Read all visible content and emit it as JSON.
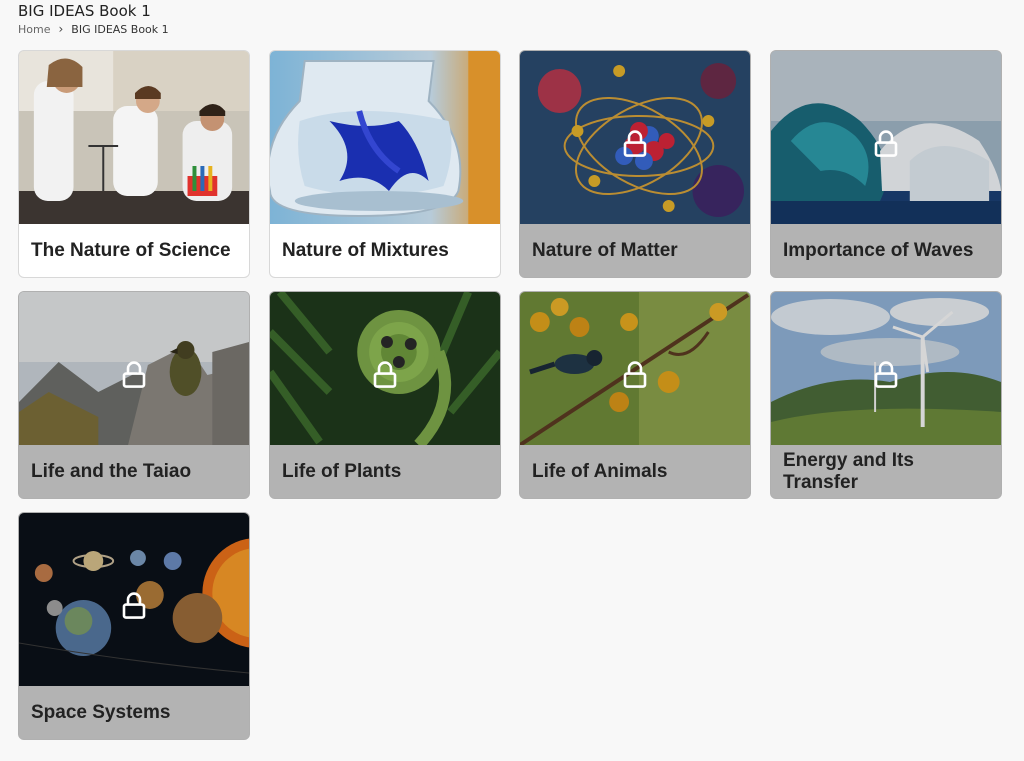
{
  "header": {
    "title": "BIG IDEAS Book 1",
    "breadcrumb": {
      "home": "Home",
      "current": "BIG IDEAS Book 1"
    }
  },
  "cards": [
    {
      "label": "The Nature of Science",
      "locked": false,
      "image": "science-lab-students"
    },
    {
      "label": "Nature of Mixtures",
      "locked": false,
      "image": "blue-ink-in-flask"
    },
    {
      "label": "Nature of Matter",
      "locked": true,
      "image": "atom-model"
    },
    {
      "label": "Importance of Waves",
      "locked": true,
      "image": "ocean-wave"
    },
    {
      "label": "Life and the Taiao",
      "locked": true,
      "image": "kea-on-mountain"
    },
    {
      "label": "Life of Plants",
      "locked": true,
      "image": "fern-frond"
    },
    {
      "label": "Life of Animals",
      "locked": true,
      "image": "tui-on-kowhai"
    },
    {
      "label": "Energy and Its Transfer",
      "locked": true,
      "image": "wind-turbines"
    },
    {
      "label": "Space Systems",
      "locked": true,
      "image": "solar-system"
    }
  ],
  "icons": {
    "lock": "lock-icon",
    "breadcrumb_separator": "chevron-right-icon"
  }
}
